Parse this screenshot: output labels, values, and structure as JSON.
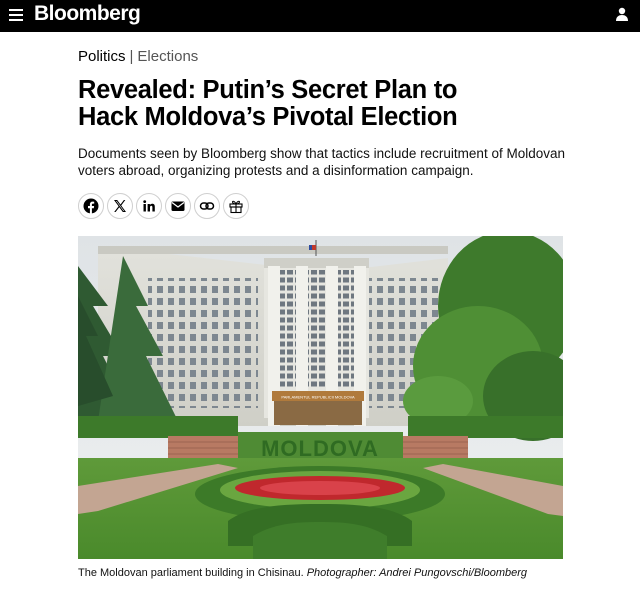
{
  "header": {
    "logo": "Bloomberg",
    "menu_icon": "hamburger-menu-icon",
    "user_icon": "user-account-icon"
  },
  "breadcrumb": {
    "primary": "Politics",
    "separator": "|",
    "secondary": "Elections"
  },
  "article": {
    "headline_line1": "Revealed: Putin’s Secret Plan to",
    "headline_line2": "Hack Moldova’s Pivotal Election",
    "dek": "Documents seen by Bloomberg show that tactics include recruitment of Moldovan voters abroad, organizing protests and a disinformation campaign."
  },
  "share": {
    "buttons": [
      {
        "icon": "facebook-icon"
      },
      {
        "icon": "x-twitter-icon"
      },
      {
        "icon": "linkedin-icon"
      },
      {
        "icon": "email-icon"
      },
      {
        "icon": "copy-link-icon"
      },
      {
        "icon": "gift-icon"
      }
    ]
  },
  "photo": {
    "building_sign": "PARLAMENTUL REPUBLICII MOLDOVA",
    "hedge_text": "MOLDOVA",
    "caption": "The Moldovan parliament building in Chisinau.",
    "credit": "Photographer: Andrei Pungovschi/Bloomberg"
  },
  "colors": {
    "topbar": "#000000",
    "text_primary": "#000000",
    "text_secondary": "#555555"
  }
}
